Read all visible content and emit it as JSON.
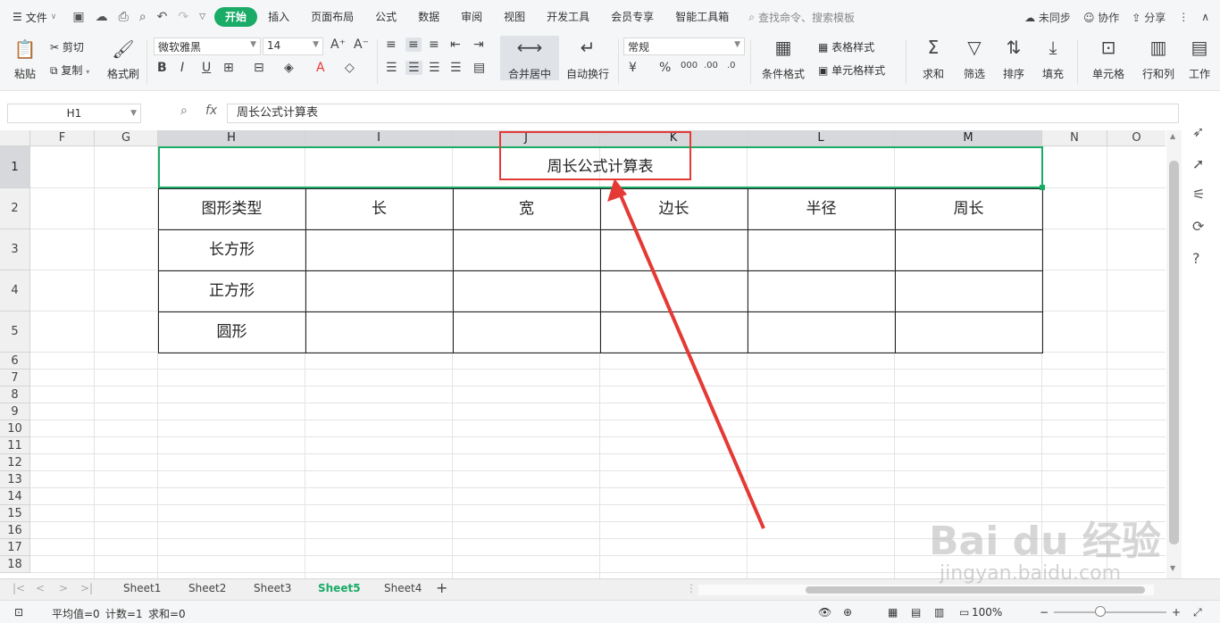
{
  "menubar": {
    "file_label": "文件",
    "tabs": [
      "开始",
      "插入",
      "页面布局",
      "公式",
      "数据",
      "审阅",
      "视图",
      "开发工具",
      "会员专享",
      "智能工具箱"
    ],
    "search_placeholder": "查找命令、搜索模板",
    "unsync_label": "未同步",
    "collab_label": "协作",
    "share_label": "分享"
  },
  "ribbon": {
    "paste": "粘贴",
    "cut": "剪切",
    "copy": "复制",
    "format_painter": "格式刷",
    "font_name": "微软雅黑",
    "font_size": "14",
    "merge_center": "合并居中",
    "wrap_text": "自动换行",
    "number_format": "常规",
    "table_style": "表格样式",
    "cell_style": "单元格样式",
    "cond_format": "条件格式",
    "sum": "求和",
    "filter": "筛选",
    "sort": "排序",
    "fill": "填充",
    "cell": "单元格",
    "row_col": "行和列",
    "worksheet": "工作"
  },
  "formula_bar": {
    "name_box": "H1",
    "fx": "fx",
    "content": "周长公式计算表"
  },
  "grid": {
    "columns": [
      "F",
      "G",
      "H",
      "I",
      "J",
      "K",
      "L",
      "M",
      "N",
      "O"
    ],
    "rows": [
      "1",
      "2",
      "3",
      "4",
      "5",
      "6",
      "7",
      "8",
      "9",
      "10",
      "11",
      "12",
      "13",
      "14",
      "15",
      "16",
      "17",
      "18"
    ],
    "title": "周长公式计算表",
    "headers": [
      "图形类型",
      "长",
      "宽",
      "边长",
      "半径",
      "周长"
    ],
    "shapes": [
      "长方形",
      "正方形",
      "圆形"
    ]
  },
  "sheets": [
    "Sheet1",
    "Sheet2",
    "Sheet3",
    "Sheet5",
    "Sheet4"
  ],
  "active_sheet": "Sheet5",
  "status": {
    "average": "平均值=0",
    "count": "计数=1",
    "sum": "求和=0",
    "zoom": "100%"
  },
  "watermark": {
    "brand": "Bai du 经验",
    "url": "jingyan.baidu.com"
  },
  "colors": {
    "accent": "#1aab67",
    "selection": "#1aab67",
    "annotation": "#e53935"
  }
}
